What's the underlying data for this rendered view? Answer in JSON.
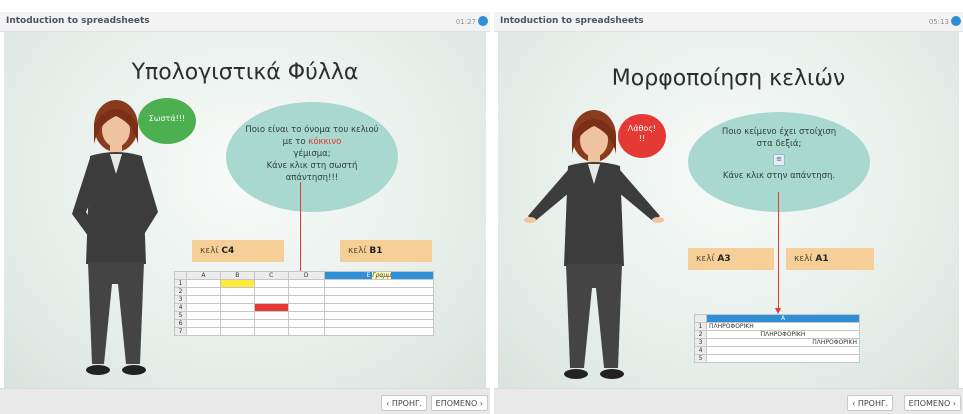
{
  "left": {
    "header_title": "Intoduction to spreadsheets",
    "timer": "01:27",
    "slide_title": "Υπολογιστικά Φύλλα",
    "feedback": "Σωστά!!!",
    "question_before": "Ποιο είναι το όνομα του κελιού με το",
    "question_highlight": "κόκκινο",
    "question_after": "γέμισμα;\nΚάνε κλικ στη σωστή απάντηση!!!",
    "answer1": {
      "prefix": "κελί",
      "cell": "C4"
    },
    "answer2": {
      "prefix": "κελί",
      "cell": "B1"
    },
    "sheet": {
      "columns": [
        "A",
        "B",
        "C",
        "D",
        "E"
      ],
      "extra_label": "Γραμμ",
      "rows": [
        "1",
        "2",
        "3",
        "4",
        "5",
        "6",
        "7"
      ]
    },
    "colors": {
      "correct": "#4caf50",
      "fill_yellow": "#ffeb3b",
      "fill_red": "#e53935"
    },
    "prev": "ΠΡΟΗΓ.",
    "next": "ΕΠΟΜΕΝΟ"
  },
  "right": {
    "header_title": "Intoduction to spreadsheets",
    "timer": "05:13",
    "slide_title": "Μορφοποίηση κελιών",
    "feedback": "Λάθος!\n!!",
    "question_line1": "Ποιο κείμενο έχει στοίχιση",
    "question_line2": "στα δεξιά;",
    "question_line3": "Κάνε κλικ στην απάντηση.",
    "answer1": {
      "prefix": "κελί",
      "cell": "A3"
    },
    "answer2": {
      "prefix": "κελί",
      "cell": "A1"
    },
    "sheet": {
      "column": "A",
      "rows": [
        {
          "n": "1",
          "text": "ΠΛΗΡΟΦΟΡΙΚΗ",
          "align": "left"
        },
        {
          "n": "2",
          "text": "ΠΛΗΡΟΦΟΡΙΚΗ",
          "align": "center"
        },
        {
          "n": "3",
          "text": "ΠΛΗΡΟΦΟΡΙΚΗ",
          "align": "right"
        },
        {
          "n": "4",
          "text": "",
          "align": "left"
        },
        {
          "n": "5",
          "text": "",
          "align": "left"
        }
      ]
    },
    "colors": {
      "wrong": "#e53935",
      "header_blue": "#2f8fd6"
    },
    "prev": "ΠΡΟΗΓ.",
    "next": "ΕΠΟΜΕΝΟ"
  }
}
